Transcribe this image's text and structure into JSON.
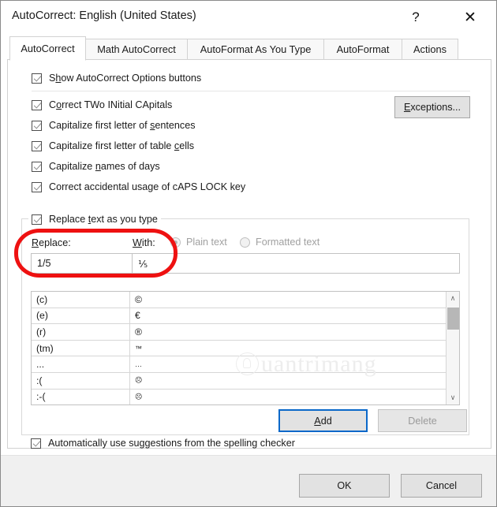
{
  "window": {
    "title": "AutoCorrect: English (United States)",
    "help_icon": "?",
    "close_icon": "✕"
  },
  "tabs": [
    {
      "label": "AutoCorrect",
      "active": true
    },
    {
      "label": "Math AutoCorrect",
      "active": false
    },
    {
      "label": "AutoFormat As You Type",
      "active": false
    },
    {
      "label": "AutoFormat",
      "active": false
    },
    {
      "label": "Actions",
      "active": false
    }
  ],
  "options": [
    {
      "label_pre": "S",
      "label_key": "h",
      "label_post": "ow AutoCorrect Options buttons",
      "checked": true
    },
    {
      "label_pre": "C",
      "label_key": "o",
      "label_post": "rrect TWo INitial CApitals",
      "checked": true
    },
    {
      "label_pre": "Capitalize first letter of ",
      "label_key": "s",
      "label_post": "entences",
      "checked": true
    },
    {
      "label_pre": "Capitalize first letter of table ",
      "label_key": "c",
      "label_post": "ells",
      "checked": true
    },
    {
      "label_pre": "Capitalize ",
      "label_key": "n",
      "label_post": "ames of days",
      "checked": true
    },
    {
      "label_pre": "Correct accidental usage of cAPS LOCK key",
      "label_key": "",
      "label_post": "",
      "checked": true
    }
  ],
  "exceptions_button": {
    "pre": "",
    "key": "E",
    "post": "xceptions..."
  },
  "replace_group": {
    "legend": {
      "pre": "Replace ",
      "key": "t",
      "post": "ext as you type"
    },
    "legend_checked": true,
    "replace_label": {
      "pre": "",
      "key": "R",
      "post": "eplace:"
    },
    "with_label": {
      "pre": "",
      "key": "W",
      "post": "ith:"
    },
    "radios": [
      {
        "label": "Plain text",
        "selected": true,
        "disabled": true
      },
      {
        "label": "Formatted text",
        "selected": false,
        "disabled": true
      }
    ],
    "replace_value": "1/5",
    "with_value": "⅕",
    "replace_placeholder": "",
    "with_placeholder": ""
  },
  "entries": {
    "columns": [
      "Replace",
      "With"
    ],
    "rows": [
      {
        "replace": "(c)",
        "with": "©",
        "small": false
      },
      {
        "replace": "(e)",
        "with": "€",
        "small": false
      },
      {
        "replace": "(r)",
        "with": "®",
        "small": false
      },
      {
        "replace": "(tm)",
        "with": "™",
        "small": true
      },
      {
        "replace": "...",
        "with": "…",
        "small": true
      },
      {
        "replace": ":(",
        "with": "☹",
        "small": true
      },
      {
        "replace": ":-(",
        "with": "☹",
        "small": true
      }
    ],
    "scroll_up_icon": "∧",
    "scroll_down_icon": "∨"
  },
  "list_buttons": {
    "add": {
      "pre": "",
      "key": "A",
      "post": "dd"
    },
    "delete": {
      "label": "Delete",
      "disabled": true
    }
  },
  "spelling_checkbox": {
    "label": "Automatically use suggestions from the spelling checker",
    "checked": true
  },
  "footer": {
    "ok": "OK",
    "cancel": "Cancel"
  },
  "watermark": {
    "text": "uantrimang"
  },
  "colors": {
    "annotation": "#ee1111",
    "focus_border": "#0a68c9",
    "dialog_bg": "#ffffff",
    "footer_bg": "#f0f0f0"
  }
}
